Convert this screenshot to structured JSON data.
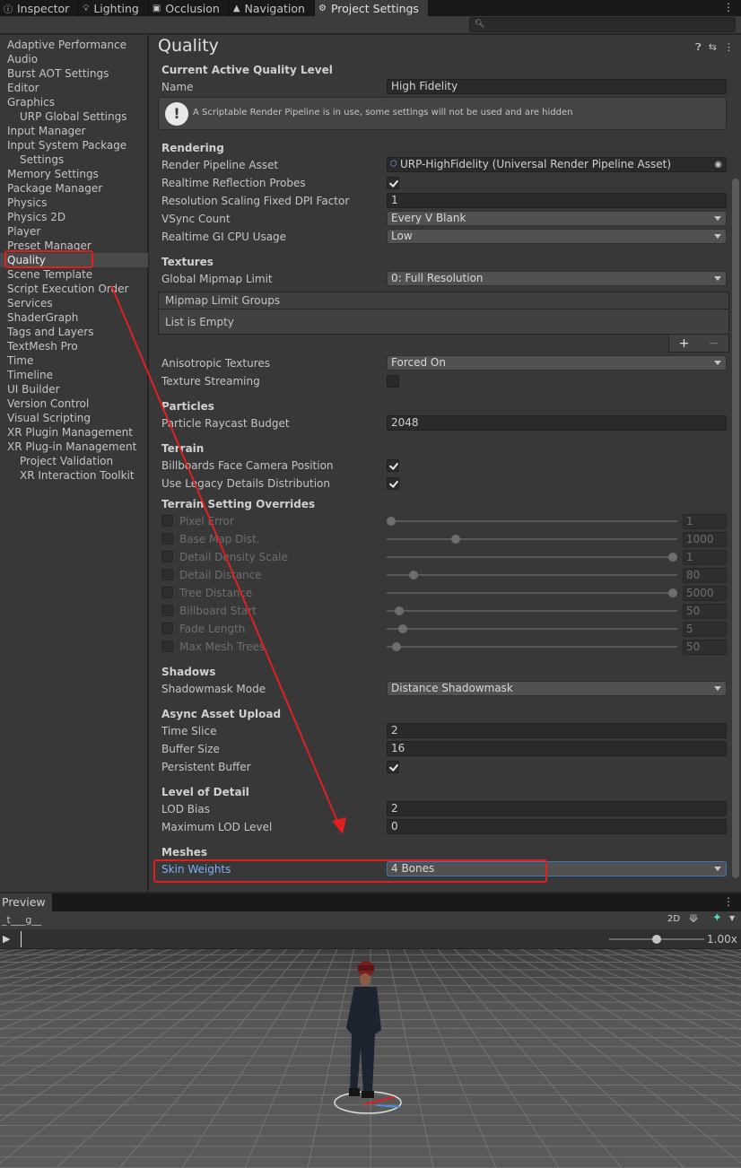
{
  "tabs": [
    {
      "label": "Inspector",
      "icon": "info-icon"
    },
    {
      "label": "Lighting",
      "icon": "bulb-icon"
    },
    {
      "label": "Occlusion",
      "icon": "occlusion-icon"
    },
    {
      "label": "Navigation",
      "icon": "navigation-icon"
    },
    {
      "label": "Project Settings",
      "icon": "gear-icon",
      "active": true
    }
  ],
  "sidebar": {
    "items": [
      {
        "label": "Adaptive Performance"
      },
      {
        "label": "Audio"
      },
      {
        "label": "Burst AOT Settings"
      },
      {
        "label": "Editor"
      },
      {
        "label": "Graphics"
      },
      {
        "label": "URP Global Settings",
        "child": true
      },
      {
        "label": "Input Manager"
      },
      {
        "label": "Input System Package"
      },
      {
        "label": "Settings",
        "child": true
      },
      {
        "label": "Memory Settings"
      },
      {
        "label": "Package Manager"
      },
      {
        "label": "Physics"
      },
      {
        "label": "Physics 2D"
      },
      {
        "label": "Player"
      },
      {
        "label": "Preset Manager"
      },
      {
        "label": "Quality",
        "selected": true
      },
      {
        "label": "Scene Template"
      },
      {
        "label": "Script Execution Order"
      },
      {
        "label": "Services"
      },
      {
        "label": "ShaderGraph"
      },
      {
        "label": "Tags and Layers"
      },
      {
        "label": "TextMesh Pro"
      },
      {
        "label": "Time"
      },
      {
        "label": "Timeline"
      },
      {
        "label": "UI Builder"
      },
      {
        "label": "Version Control"
      },
      {
        "label": "Visual Scripting"
      },
      {
        "label": "XR Plugin Management"
      },
      {
        "label": "XR Plug-in Management"
      },
      {
        "label": "Project Validation",
        "child": true
      },
      {
        "label": "XR Interaction Toolkit",
        "child": true
      }
    ]
  },
  "main": {
    "title": "Quality",
    "current_level": {
      "header": "Current Active Quality Level",
      "name_label": "Name",
      "name_value": "High Fidelity",
      "help": "A Scriptable Render Pipeline is in use, some settings will not be used and are hidden"
    },
    "rendering": {
      "header": "Rendering",
      "pipeline_label": "Render Pipeline Asset",
      "pipeline_value": "URP-HighFidelity (Universal Render Pipeline Asset)",
      "reflection_label": "Realtime Reflection Probes",
      "dpi_label": "Resolution Scaling Fixed DPI Factor",
      "dpi_value": "1",
      "vsync_label": "VSync Count",
      "vsync_value": "Every V Blank",
      "gi_label": "Realtime GI CPU Usage",
      "gi_value": "Low"
    },
    "textures": {
      "header": "Textures",
      "mipmap_label": "Global Mipmap Limit",
      "mipmap_value": "0: Full Resolution",
      "groups_header": "Mipmap Limit Groups",
      "groups_empty": "List is Empty",
      "add": "+",
      "remove": "−",
      "aniso_label": "Anisotropic Textures",
      "aniso_value": "Forced On",
      "streaming_label": "Texture Streaming"
    },
    "particles": {
      "header": "Particles",
      "raycast_label": "Particle Raycast Budget",
      "raycast_value": "2048"
    },
    "terrain": {
      "header": "Terrain",
      "billboards_label": "Billboards Face Camera Position",
      "legacy_label": "Use Legacy Details Distribution"
    },
    "overrides": {
      "header": "Terrain Setting Overrides",
      "items": [
        {
          "label": "Pixel Error",
          "value": "1",
          "level": 0.0
        },
        {
          "label": "Base Map Dist.",
          "value": "1000",
          "level": 0.23
        },
        {
          "label": "Detail Density Scale",
          "value": "1",
          "level": 1.0
        },
        {
          "label": "Detail Distance",
          "value": "80",
          "level": 0.08
        },
        {
          "label": "Tree Distance",
          "value": "5000",
          "level": 1.0
        },
        {
          "label": "Billboard Start",
          "value": "50",
          "level": 0.03
        },
        {
          "label": "Fade Length",
          "value": "5",
          "level": 0.04
        },
        {
          "label": "Max Mesh Trees",
          "value": "50",
          "level": 0.02
        }
      ]
    },
    "shadows": {
      "header": "Shadows",
      "mode_label": "Shadowmask Mode",
      "mode_value": "Distance Shadowmask"
    },
    "async": {
      "header": "Async Asset Upload",
      "slice_label": "Time Slice",
      "slice_value": "2",
      "buffer_label": "Buffer Size",
      "buffer_value": "16",
      "persistent_label": "Persistent Buffer"
    },
    "lod": {
      "header": "Level of Detail",
      "bias_label": "LOD Bias",
      "bias_value": "2",
      "max_label": "Maximum LOD Level",
      "max_value": "0"
    },
    "meshes": {
      "header": "Meshes",
      "skin_label": "Skin Weights",
      "skin_value": "4 Bones"
    }
  },
  "preview": {
    "tab": "Preview",
    "title": "_t___g__",
    "mode_2d": "2D",
    "speed": "1.00x",
    "speed_level": 0.5
  },
  "colors": {
    "accent_link": "#7bb0f5",
    "annotation": "#e02020"
  }
}
